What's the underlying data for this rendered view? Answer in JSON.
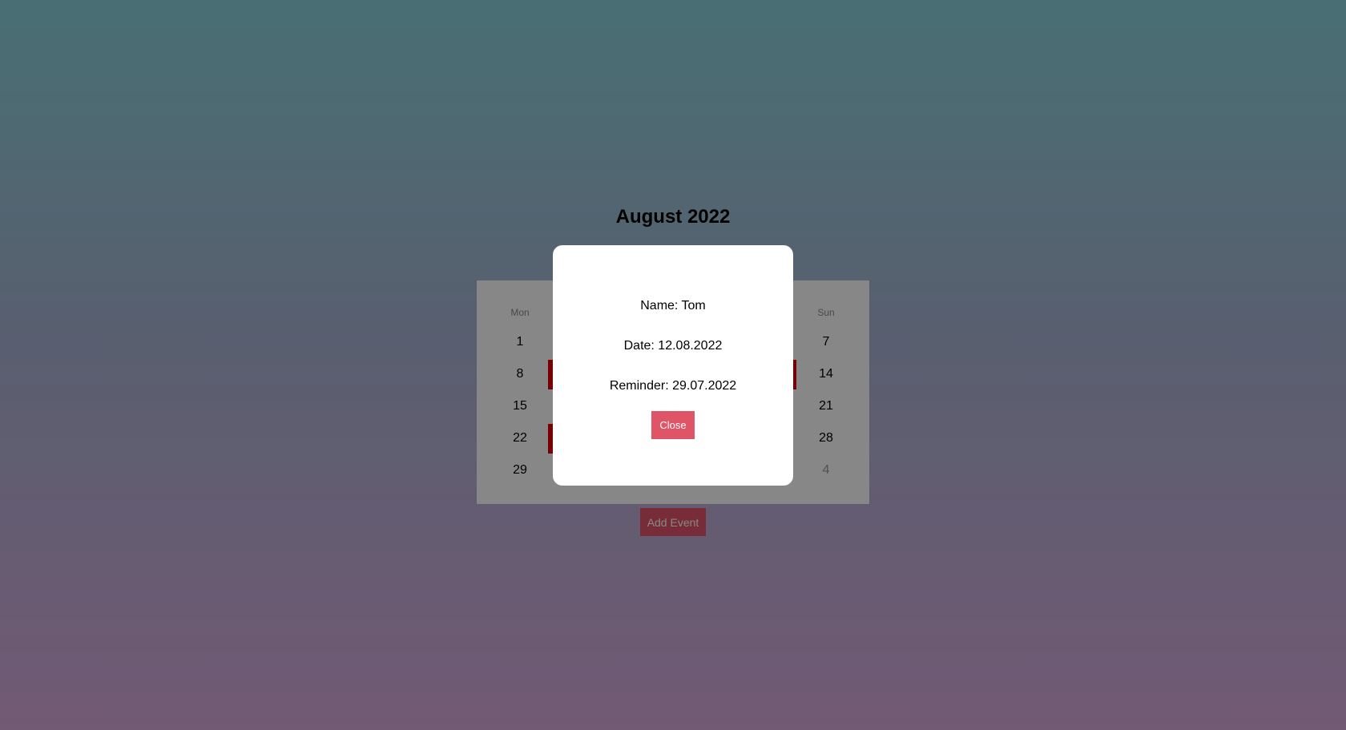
{
  "calendar": {
    "title": "August 2022",
    "weekdays": [
      "Mon",
      "Sun"
    ],
    "rows": [
      {
        "mon": "1",
        "sun": "7"
      },
      {
        "mon": "8",
        "sun": "14"
      },
      {
        "mon": "15",
        "sun": "21"
      },
      {
        "mon": "22",
        "sun": "28"
      },
      {
        "mon": "29",
        "sun": "4"
      }
    ],
    "event_color": "#e00000"
  },
  "actions": {
    "add_event_label": "Add Event"
  },
  "modal": {
    "name_line": "Name: Tom",
    "date_line": "Date: 12.08.2022",
    "reminder_line": "Reminder: 29.07.2022",
    "close_label": "Close"
  },
  "colors": {
    "accent": "#e05468",
    "overlay": "rgba(0,0,0,0.47)"
  }
}
